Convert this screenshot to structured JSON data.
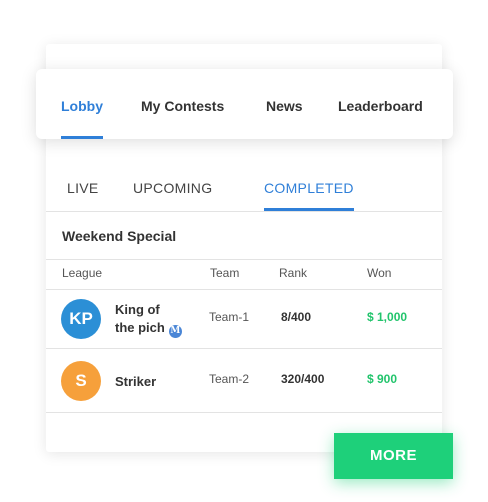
{
  "top_tabs": [
    {
      "label": "Lobby",
      "active": true
    },
    {
      "label": "My Contests",
      "active": false
    },
    {
      "label": "News",
      "active": false
    },
    {
      "label": "Leaderboard",
      "active": false
    }
  ],
  "sub_tabs": [
    {
      "label": "LIVE",
      "active": false
    },
    {
      "label": "UPCOMING",
      "active": false
    },
    {
      "label": "COMPLETED",
      "active": true
    }
  ],
  "section_title": "Weekend Special",
  "columns": [
    "League",
    "Team",
    "Rank",
    "Won"
  ],
  "rows": [
    {
      "initials": "KP",
      "avatar_color": "#2b8fd6",
      "name_line1": "King of",
      "name_line2": "the pich",
      "badge": "M",
      "team": "Team-1",
      "rank": "8/400",
      "won": "$ 1,000"
    },
    {
      "initials": "S",
      "avatar_color": "#f6a03b",
      "name_line1": "Striker",
      "team": "Team-2",
      "rank": "320/400",
      "won": "$ 900"
    }
  ],
  "more_button": "MORE",
  "colors": {
    "accent": "#2f7fd8",
    "won": "#22c46c",
    "button": "#1ed07a"
  }
}
